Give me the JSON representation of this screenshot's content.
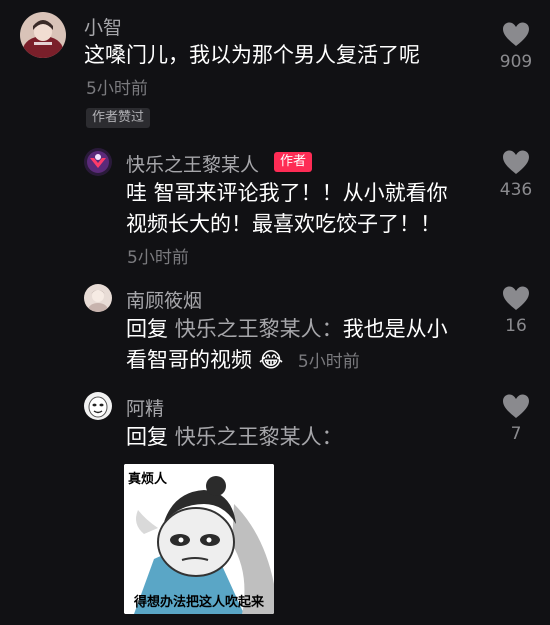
{
  "comments": [
    {
      "username": "小智",
      "text": "这嗓门儿，我以为那个男人复活了呢",
      "time": "5小时前",
      "badge": "作者赞过",
      "likes": "909",
      "icons": {
        "avatar": "avatar-xiaozhi",
        "like": "heart-icon"
      }
    },
    {
      "username": "快乐之王黎某人",
      "author_badge": "作者",
      "text_line1": "哇 智哥来评论我了！！从小就看你",
      "text_line2": "视频长大的！最喜欢吃饺子了！！",
      "time": "5小时前",
      "likes": "436",
      "icons": {
        "avatar": "avatar-kuaile",
        "like": "heart-icon"
      }
    },
    {
      "username": "南顾筱烟",
      "reply_prefix": "回复",
      "reply_to": "快乐之王黎某人：",
      "text_line1": "我也是从小",
      "text_line2": "看智哥的视频",
      "emoji": "😂",
      "time": "5小时前",
      "likes": "16",
      "icons": {
        "avatar": "avatar-nangu",
        "like": "heart-icon"
      }
    },
    {
      "username": "阿精",
      "reply_prefix": "回复",
      "reply_to": "快乐之王黎某人：",
      "likes": "7",
      "sticker": {
        "top_text": "真烦人",
        "bottom_text": "得想办法把这人吹起来"
      },
      "icons": {
        "avatar": "avatar-ajing",
        "like": "heart-icon"
      }
    }
  ],
  "colors": {
    "background": "#111114",
    "author_badge": "#fe2c55",
    "secondary_text": "#a6a6aa"
  }
}
